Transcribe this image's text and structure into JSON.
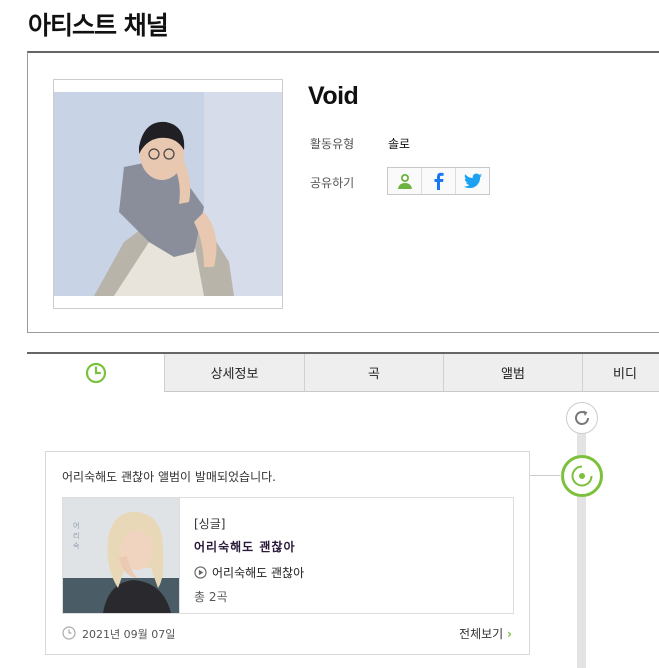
{
  "page": {
    "title": "아티스트 채널"
  },
  "artist": {
    "name": "Void",
    "activity_type_label": "활동유형",
    "activity_type_value": "솔로",
    "share_label": "공유하기",
    "share_buttons": [
      "kakao-icon",
      "facebook-icon",
      "twitter-icon"
    ]
  },
  "tabs": [
    "상세정보",
    "곡",
    "앨범",
    "비디"
  ],
  "timeline": {
    "event_text": "어리숙해도 괜찮아 앨범이 발매되었습니다.",
    "album": {
      "type": "[싱글]",
      "title": "어리숙해도 괜찮아",
      "track": "어리숙해도 괜찮아",
      "track_count": "총 2곡"
    },
    "date": "2021년 09월 07일",
    "view_all": "전체보기"
  },
  "colors": {
    "accent": "#7cc13c",
    "facebook": "#1877f2",
    "twitter": "#1da1f2"
  }
}
